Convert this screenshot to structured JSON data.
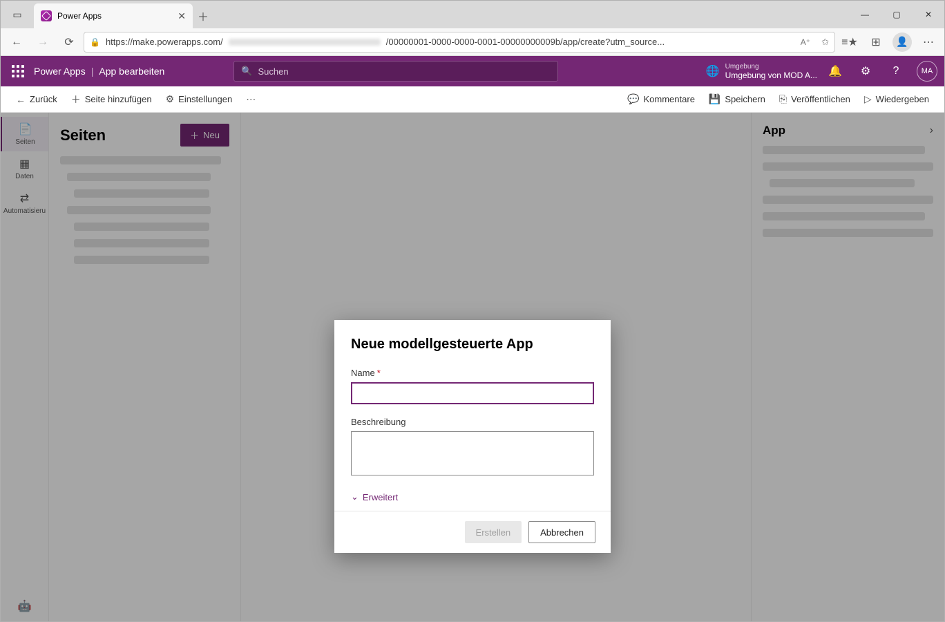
{
  "browser": {
    "tab_title": "Power Apps",
    "url_prefix": "https://make.powerapps.com/",
    "url_suffix": "/00000001-0000-0000-0001-00000000009b/app/create?utm_source..."
  },
  "header": {
    "app_name": "Power Apps",
    "separator": "|",
    "context": "App bearbeiten",
    "search_placeholder": "Suchen",
    "env_label": "Umgebung",
    "env_value": "Umgebung von MOD A...",
    "user_initials": "MA"
  },
  "commands": {
    "back": "Zurück",
    "add_page": "Seite hinzufügen",
    "settings": "Einstellungen",
    "comments": "Kommentare",
    "save": "Speichern",
    "publish": "Veröffentlichen",
    "play": "Wiedergeben"
  },
  "rail": {
    "pages": "Seiten",
    "data": "Daten",
    "automation": "Automatisieru"
  },
  "pages_panel": {
    "title": "Seiten",
    "new": "Neu"
  },
  "right_panel": {
    "title": "App"
  },
  "dialog": {
    "title": "Neue modellgesteuerte App",
    "name_label": "Name",
    "desc_label": "Beschreibung",
    "advanced": "Erweitert",
    "create": "Erstellen",
    "cancel": "Abbrechen"
  }
}
